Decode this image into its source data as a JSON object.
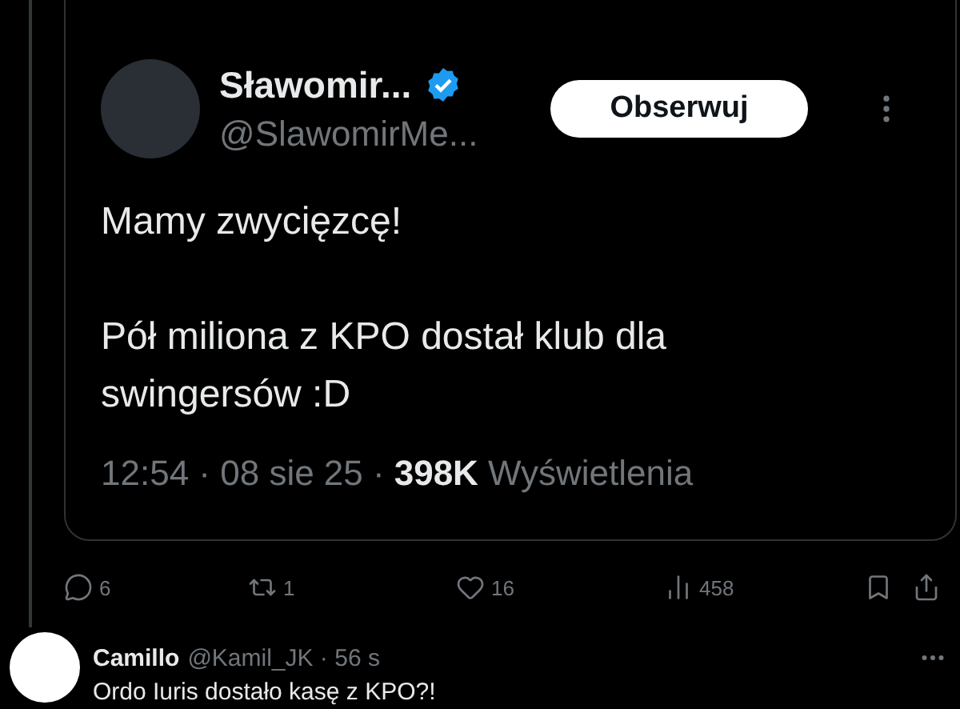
{
  "quoted_tweet": {
    "author_name": "Sławomir...",
    "verified": true,
    "handle": "@SlawomirMe...",
    "follow_button": "Obserwuj",
    "paragraphs": [
      [
        "Mamy zwycięzcę!"
      ],
      [
        "Pół miliona z KPO dostał klub dla",
        "swingersów :D"
      ]
    ],
    "time_and_date": "12:54 · 08 sie 25 ·",
    "views": "398K",
    "views_label": "Wyświetlenia"
  },
  "actions": [
    {
      "kind": "reply",
      "count": "6"
    },
    {
      "kind": "repost",
      "count": "1"
    },
    {
      "kind": "like",
      "count": "16"
    },
    {
      "kind": "views",
      "count": "458"
    },
    {
      "kind": "bookmark"
    },
    {
      "kind": "share"
    }
  ],
  "reply": {
    "author_name": "Camillo",
    "handle_and_age": "@Kamil_JK · 56 s",
    "text": "Ordo Iuris dostało kasę z KPO?!"
  }
}
